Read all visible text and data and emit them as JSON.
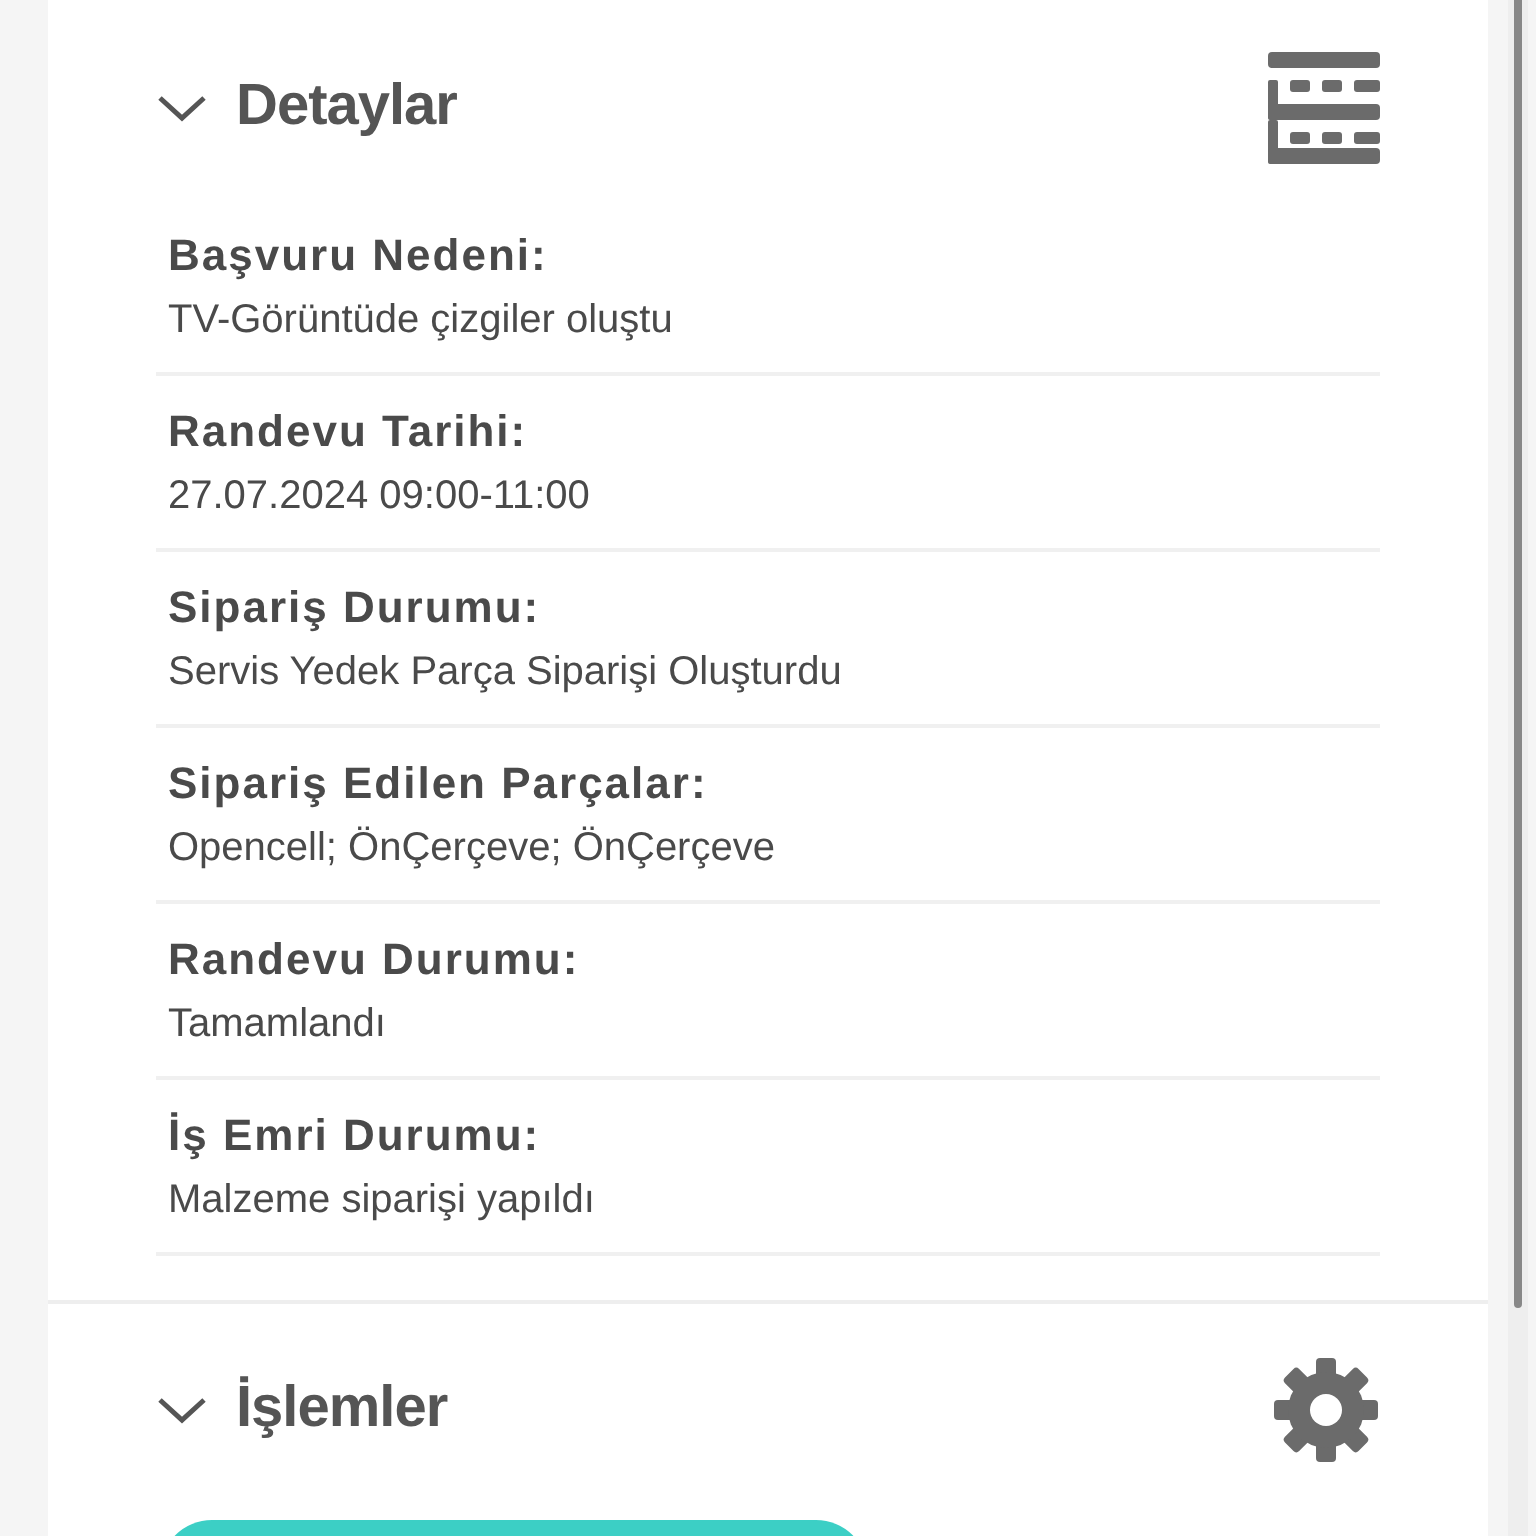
{
  "sections": [
    {
      "title": "Detaylar",
      "expanded": true,
      "kind": "details",
      "fields": [
        {
          "label": "Başvuru Nedeni:",
          "value": "TV-Görüntüde çizgiler oluştu"
        },
        {
          "label": "Randevu Tarihi:",
          "value": "27.07.2024 09:00-11:00"
        },
        {
          "label": "Sipariş Durumu:",
          "value": "Servis Yedek Parça Siparişi Oluşturdu"
        },
        {
          "label": "Sipariş Edilen Parçalar:",
          "value": "Opencell; ÖnÇerçeve; ÖnÇerçeve"
        },
        {
          "label": "Randevu Durumu:",
          "value": "Tamamlandı"
        },
        {
          "label": "İş Emri Durumu:",
          "value": "Malzeme siparişi yapıldı"
        }
      ]
    },
    {
      "title": "İşlemler",
      "expanded": true,
      "kind": "actions",
      "buttons": [
        {
          "kind": "primary"
        }
      ]
    }
  ]
}
